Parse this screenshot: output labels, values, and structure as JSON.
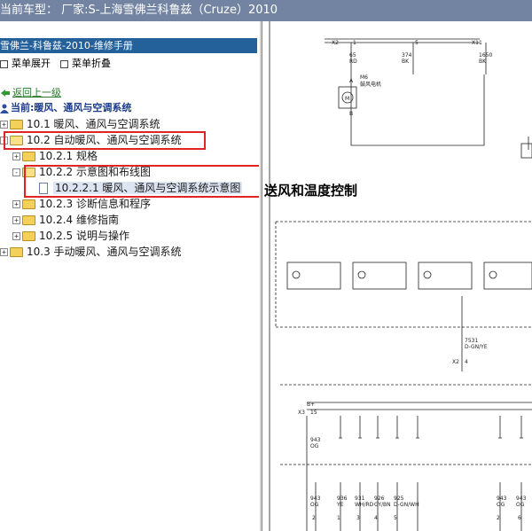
{
  "window": {
    "title": "当前车型： 厂家:S-上海雪佛兰科鲁兹（Cruze）2010"
  },
  "manual": {
    "header": "雪佛兰-科鲁兹-2010-维修手册",
    "expand_label": "菜单展开",
    "collapse_label": "菜单折叠"
  },
  "tree": {
    "up_label": "返回上一级",
    "current_label": "当前:暖风、通风与空调系统",
    "items": [
      {
        "label": "10.1 暖风、通风与空调系统",
        "toggle": "+"
      },
      {
        "label": "10.2 自动暖风、通风与空调系统",
        "toggle": "-"
      },
      {
        "label": "10.2.1 规格",
        "toggle": "+"
      },
      {
        "label": "10.2.2 示意图和布线图",
        "toggle": "-"
      },
      {
        "label": "10.2.2.1 暖风、通风与空调系统示意图"
      },
      {
        "label": "10.2.3 诊断信息和程序",
        "toggle": "+"
      },
      {
        "label": "10.2.4 维修指南",
        "toggle": "+"
      },
      {
        "label": "10.2.5 说明与操作",
        "toggle": "+"
      },
      {
        "label": "10.3 手动暖风、通风与空调系统",
        "toggle": "+"
      }
    ]
  },
  "diagram": {
    "title": "送风和温度控制",
    "connectors": {
      "x2_top": "X2",
      "x1_top": "X1",
      "x2_mid": "X2",
      "x3": "X3"
    },
    "pins": {
      "p1": "1",
      "p5": "5",
      "p2": "2",
      "p3": "3",
      "p4": "4",
      "p6": "6",
      "p15": "15"
    },
    "top_wires": [
      {
        "num": "65",
        "color": "RD"
      },
      {
        "num": "374",
        "color": "BK"
      },
      {
        "num": "1650",
        "color": "BK"
      }
    ],
    "motor": {
      "id": "M6",
      "name": "鼓风电机",
      "symbol": "M",
      "pin_a": "A",
      "pin_b": "B"
    },
    "mid_wire": {
      "num": "7531",
      "color": "D-GN/YE"
    },
    "b_plus": "B+",
    "left_wire": {
      "num": "943",
      "color": "OG"
    },
    "bottom_wires": [
      {
        "num": "943",
        "color": "OG"
      },
      {
        "num": "936",
        "color": "YE"
      },
      {
        "num": "931",
        "color": "WH/RD"
      },
      {
        "num": "926",
        "color": "GY/BN"
      },
      {
        "num": "925",
        "color": "D-GN/WH"
      },
      {
        "num": "943",
        "color": "OG"
      },
      {
        "num": "943",
        "color": "OG"
      }
    ]
  },
  "colors": {
    "title_bar": "#7384a3",
    "manual_header": "#24609a",
    "highlight": "#e02424"
  }
}
